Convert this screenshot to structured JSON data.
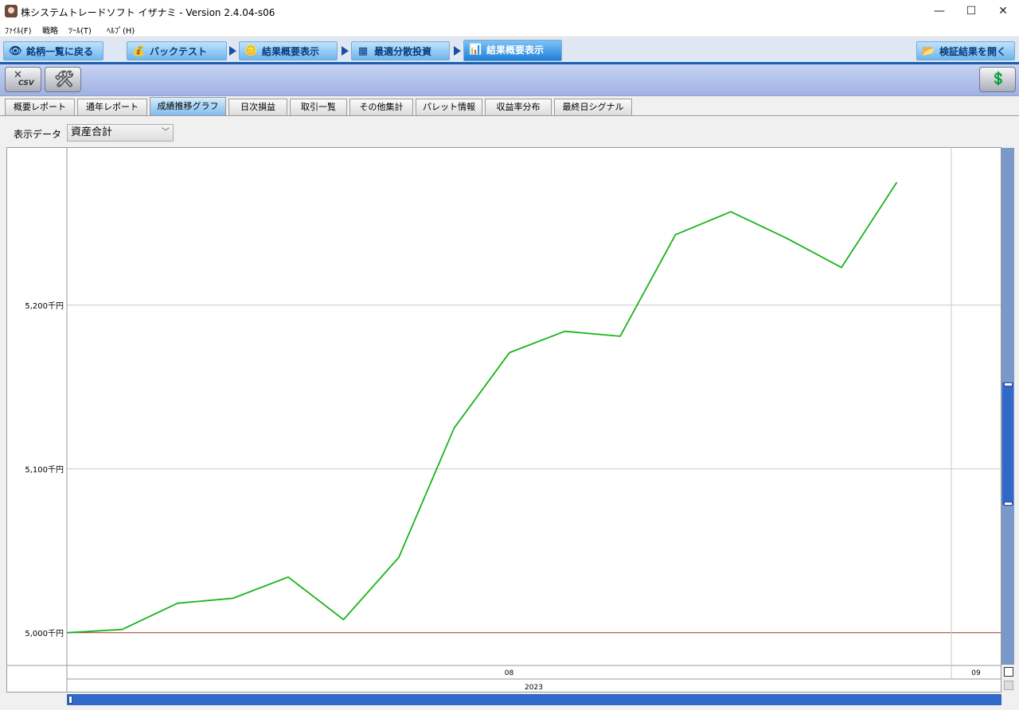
{
  "window": {
    "title": "株システムトレードソフト イザナミ - Version 2.4.04-s06",
    "minimize": "—",
    "maximize": "☐",
    "close": "✕"
  },
  "menu": [
    "ﾌｧｲﾙ(F)",
    "戦略",
    "ﾂｰﾙ(T)",
    "ﾍﾙﾌﾟ(H)"
  ],
  "nav": {
    "back": "銘柄一覧に戻る",
    "backtest": "バックテスト",
    "summary1": "結果概要表示",
    "optimize": "最適分散投資",
    "summary2": "結果概要表示",
    "open_results": "検証結果を開く"
  },
  "toolbar": {
    "csv_label": "CSV"
  },
  "tabs": [
    "概要レポート",
    "通年レポート",
    "成績推移グラフ",
    "日次損益",
    "取引一覧",
    "その他集計",
    "パレット情報",
    "収益率分布",
    "最終日シグナル"
  ],
  "active_tab": "成績推移グラフ",
  "display": {
    "label": "表示データ",
    "value": "資産合計"
  },
  "colors": {
    "series_line": "#19b419",
    "baseline": "#a03030",
    "grid": "#c8c8c8",
    "accent": "#1d7fd9"
  },
  "chart_data": {
    "type": "line",
    "x_groups": [
      {
        "label": "08",
        "year": "2023"
      },
      {
        "label": "09",
        "year": "2023"
      }
    ],
    "year_label": "2023",
    "y_ticks": [
      {
        "value": 5000,
        "label": "5,000千円"
      },
      {
        "value": 5100,
        "label": "5,100千円"
      },
      {
        "value": 5200,
        "label": "5,200千円"
      }
    ],
    "ylim": [
      4980,
      5296
    ],
    "baseline": 5000,
    "points_per_period": 16,
    "values": [
      5000,
      5002,
      5018,
      5021,
      5034,
      5008,
      5046,
      5125,
      5171,
      5184,
      5181,
      5243,
      5257,
      5241,
      5223,
      5275
    ]
  }
}
